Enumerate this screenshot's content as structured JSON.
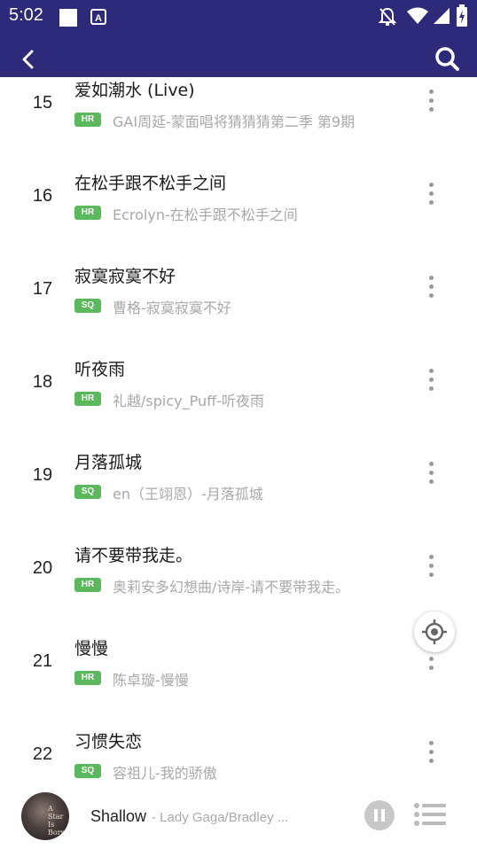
{
  "status_bar": {
    "time": "5:02",
    "icons": [
      "square-notification-icon",
      "a-notification-icon",
      "muted-bell-icon",
      "wifi-icon",
      "cell-signal-icon",
      "battery-charging-icon"
    ]
  },
  "app_bar": {
    "back_icon": "back-arrow-icon",
    "search_icon": "search-icon",
    "color": "#2e2a7a"
  },
  "songs": [
    {
      "num": "15",
      "title": "爱如潮水 (Live)",
      "badge": "HR",
      "subtitle": "GAI周延-蒙面唱将猜猜猜第二季 第9期"
    },
    {
      "num": "16",
      "title": "在松手跟不松手之间",
      "badge": "HR",
      "subtitle": "Ecrolyn-在松手跟不松手之间"
    },
    {
      "num": "17",
      "title": "寂寞寂寞不好",
      "badge": "SQ",
      "subtitle": "曹格-寂寞寂寞不好"
    },
    {
      "num": "18",
      "title": "听夜雨",
      "badge": "HR",
      "subtitle": "礼越/spicy_Puff-听夜雨"
    },
    {
      "num": "19",
      "title": "月落孤城",
      "badge": "SQ",
      "subtitle": "en（王翊恩）-月落孤城"
    },
    {
      "num": "20",
      "title": "请不要带我走。",
      "badge": "HR",
      "subtitle": "奥莉安多幻想曲/诗岸-请不要带我走。"
    },
    {
      "num": "21",
      "title": "慢慢",
      "badge": "HR",
      "subtitle": "陈卓璇-慢慢"
    },
    {
      "num": "22",
      "title": "习惯失恋",
      "badge": "SQ",
      "subtitle": "容祖儿-我的骄傲"
    }
  ],
  "badge_color": "#5cb85c",
  "player": {
    "title": "Shallow",
    "artist": " - Lady Gaga/Bradley ...",
    "album_label": "A Star Is Born"
  }
}
